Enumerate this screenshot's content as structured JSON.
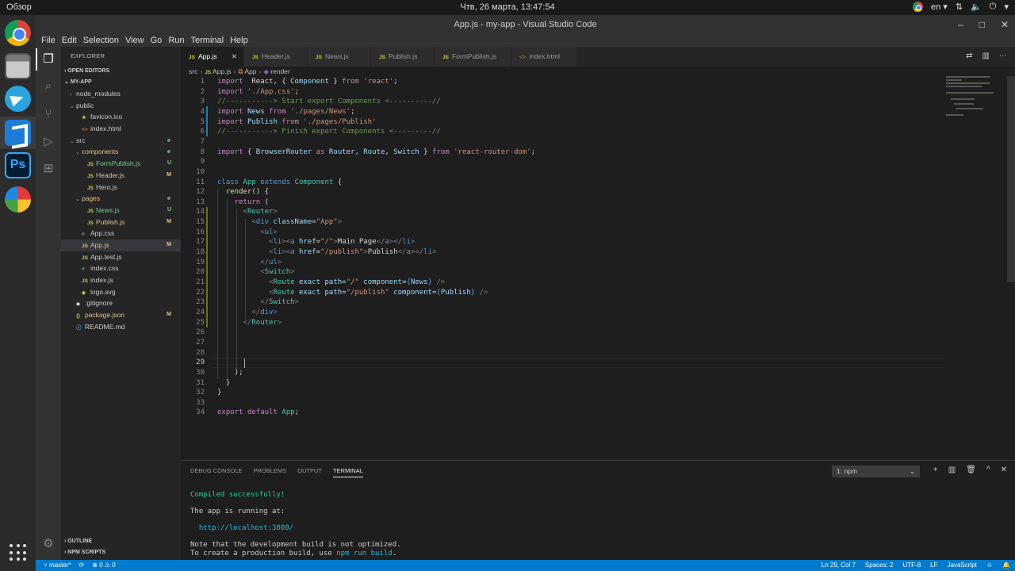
{
  "topbar": {
    "activities": "Обзор",
    "clock": "Чтв, 26 марта, 13:47:54",
    "lang": "en ▾",
    "network_icon": "network-icon",
    "volume_icon": "volume-icon",
    "power_icon": "power-icon"
  },
  "dock": {
    "apps": [
      "chrome",
      "files",
      "telegram",
      "vscode",
      "photoshop",
      "pinwheel"
    ],
    "ps_label": "Ps"
  },
  "window": {
    "title": "App.js - my-app - Visual Studio Code",
    "minimize": "–",
    "maximize": "□",
    "close": "✕"
  },
  "menu": [
    "File",
    "Edit",
    "Selection",
    "View",
    "Go",
    "Run",
    "Terminal",
    "Help"
  ],
  "sidebar": {
    "header": "EXPLORER",
    "open_editors": "OPEN EDITORS",
    "project": "MY-APP",
    "tree": [
      {
        "label": "node_modules",
        "depth": 1,
        "kind": "folder-closed"
      },
      {
        "label": "public",
        "depth": 1,
        "kind": "folder-open"
      },
      {
        "label": "favicon.ico",
        "depth": 2,
        "kind": "ico",
        "icon": "★"
      },
      {
        "label": "index.html",
        "depth": 2,
        "kind": "html",
        "icon": "<>"
      },
      {
        "label": "src",
        "depth": 1,
        "kind": "folder-open",
        "dot": true
      },
      {
        "label": "components",
        "depth": 2,
        "kind": "folder-open",
        "dot": true,
        "color": "m"
      },
      {
        "label": "FormPublish.js",
        "depth": 3,
        "kind": "js",
        "icon": "JS",
        "badge": "U",
        "color": "u"
      },
      {
        "label": "Header.js",
        "depth": 3,
        "kind": "js",
        "icon": "JS",
        "badge": "M",
        "color": "m"
      },
      {
        "label": "Hero.js",
        "depth": 3,
        "kind": "js",
        "icon": "JS"
      },
      {
        "label": "pages",
        "depth": 2,
        "kind": "folder-open",
        "dot": true,
        "color": "m"
      },
      {
        "label": "News.js",
        "depth": 3,
        "kind": "js",
        "icon": "JS",
        "badge": "U",
        "color": "u"
      },
      {
        "label": "Publish.js",
        "depth": 3,
        "kind": "js",
        "icon": "JS",
        "badge": "M",
        "color": "m"
      },
      {
        "label": "App.css",
        "depth": 2,
        "kind": "css",
        "icon": "#"
      },
      {
        "label": "App.js",
        "depth": 2,
        "kind": "js",
        "icon": "JS",
        "badge": "M",
        "color": "m",
        "selected": true
      },
      {
        "label": "App.test.js",
        "depth": 2,
        "kind": "js",
        "icon": "JS"
      },
      {
        "label": "index.css",
        "depth": 2,
        "kind": "css",
        "icon": "#"
      },
      {
        "label": "index.js",
        "depth": 2,
        "kind": "js",
        "icon": "JS"
      },
      {
        "label": "logo.svg",
        "depth": 2,
        "kind": "svg",
        "icon": "◈"
      },
      {
        "label": ".gitignore",
        "depth": 1,
        "kind": "git",
        "icon": "◆"
      },
      {
        "label": "package.json",
        "depth": 1,
        "kind": "json",
        "icon": "{}",
        "badge": "M",
        "color": "m"
      },
      {
        "label": "README.md",
        "depth": 1,
        "kind": "md",
        "icon": "ⓘ"
      }
    ],
    "outline": "OUTLINE",
    "npm_scripts": "NPM SCRIPTS"
  },
  "tabs": [
    {
      "label": "App.js",
      "icon": "JS",
      "active": true,
      "close": "✕"
    },
    {
      "label": "Header.js",
      "icon": "JS"
    },
    {
      "label": "News.js",
      "icon": "JS"
    },
    {
      "label": "Publish.js",
      "icon": "JS"
    },
    {
      "label": "FormPublish.js",
      "icon": "JS"
    },
    {
      "label": "index.html",
      "icon": "<>"
    }
  ],
  "breadcrumb": {
    "folder": "src",
    "file": "App.js",
    "class": "App",
    "method": "render",
    "sep": "›"
  },
  "code_lines": [
    [
      [
        "k2",
        "import"
      ],
      [
        "",
        "  React, { "
      ],
      [
        "v",
        "Component"
      ],
      [
        "",
        " } "
      ],
      [
        "k2",
        "from"
      ],
      [
        "",
        " "
      ],
      [
        "s",
        "'react'"
      ],
      [
        "",
        ";"
      ]
    ],
    [
      [
        "k2",
        "import"
      ],
      [
        "",
        " "
      ],
      [
        "s",
        "'./App.css'"
      ],
      [
        "",
        ";"
      ]
    ],
    [
      [
        "c",
        "//-----------> Start export Components <----------//"
      ]
    ],
    [
      [
        "k2",
        "import"
      ],
      [
        "",
        " "
      ],
      [
        "v",
        "News"
      ],
      [
        "",
        " "
      ],
      [
        "k2",
        "from"
      ],
      [
        "",
        " "
      ],
      [
        "s",
        "'./pages/News'"
      ],
      [
        "",
        ";"
      ]
    ],
    [
      [
        "k2",
        "import"
      ],
      [
        "",
        " "
      ],
      [
        "v",
        "Publish"
      ],
      [
        "",
        " "
      ],
      [
        "k2",
        "from"
      ],
      [
        "",
        " "
      ],
      [
        "s",
        "'./pages/Publish'"
      ]
    ],
    [
      [
        "c",
        "//-----------> Finish export Components <---------//"
      ]
    ],
    [],
    [
      [
        "k2",
        "import"
      ],
      [
        "",
        " { "
      ],
      [
        "v",
        "BrowserRouter"
      ],
      [
        "",
        " "
      ],
      [
        "k2",
        "as"
      ],
      [
        "",
        " "
      ],
      [
        "v",
        "Router"
      ],
      [
        "",
        ", "
      ],
      [
        "v",
        "Route"
      ],
      [
        "",
        ", "
      ],
      [
        "v",
        "Switch"
      ],
      [
        "",
        " } "
      ],
      [
        "k2",
        "from"
      ],
      [
        "",
        " "
      ],
      [
        "s",
        "'react-router-dom'"
      ],
      [
        "",
        ";"
      ]
    ],
    [],
    [],
    [
      [
        "k",
        "class"
      ],
      [
        "",
        " "
      ],
      [
        "cls",
        "App"
      ],
      [
        "",
        " "
      ],
      [
        "k",
        "extends"
      ],
      [
        "",
        " "
      ],
      [
        "cls",
        "Component"
      ],
      [
        "",
        " {"
      ]
    ],
    [
      [
        "",
        "  "
      ],
      [
        "f",
        "render"
      ],
      [
        "",
        "() {"
      ]
    ],
    [
      [
        "",
        "    "
      ],
      [
        "k2",
        "return"
      ],
      [
        "",
        " ("
      ]
    ],
    [
      [
        "",
        "      "
      ],
      [
        "tag",
        "<"
      ],
      [
        "cls",
        "Router"
      ],
      [
        "tag",
        ">"
      ]
    ],
    [
      [
        "",
        "        "
      ],
      [
        "tag",
        "<"
      ],
      [
        "t",
        "div"
      ],
      [
        "",
        " "
      ],
      [
        "a",
        "className"
      ],
      [
        "",
        "="
      ],
      [
        "s",
        "\"App\""
      ],
      [
        "tag",
        ">"
      ]
    ],
    [
      [
        "",
        "          "
      ],
      [
        "tag",
        "<"
      ],
      [
        "t",
        "ul"
      ],
      [
        "tag",
        ">"
      ]
    ],
    [
      [
        "",
        "            "
      ],
      [
        "tag",
        "<"
      ],
      [
        "t",
        "li"
      ],
      [
        "tag",
        "><"
      ],
      [
        "t",
        "a"
      ],
      [
        "",
        " "
      ],
      [
        "a",
        "href"
      ],
      [
        "",
        "="
      ],
      [
        "s",
        "\"/\""
      ],
      [
        "tag",
        ">"
      ],
      [
        "",
        "Main Page"
      ],
      [
        "tag",
        "</"
      ],
      [
        "t",
        "a"
      ],
      [
        "tag",
        "></"
      ],
      [
        "t",
        "li"
      ],
      [
        "tag",
        ">"
      ]
    ],
    [
      [
        "",
        "            "
      ],
      [
        "tag",
        "<"
      ],
      [
        "t",
        "li"
      ],
      [
        "tag",
        "><"
      ],
      [
        "t",
        "a"
      ],
      [
        "",
        " "
      ],
      [
        "a",
        "href"
      ],
      [
        "",
        "="
      ],
      [
        "s",
        "\"/publish\""
      ],
      [
        "tag",
        ">"
      ],
      [
        "",
        "Publish"
      ],
      [
        "tag",
        "</"
      ],
      [
        "t",
        "a"
      ],
      [
        "tag",
        "></"
      ],
      [
        "t",
        "li"
      ],
      [
        "tag",
        ">"
      ]
    ],
    [
      [
        "",
        "          "
      ],
      [
        "tag",
        "</"
      ],
      [
        "t",
        "ul"
      ],
      [
        "tag",
        ">"
      ]
    ],
    [
      [
        "",
        "          "
      ],
      [
        "tag",
        "<"
      ],
      [
        "cls",
        "Switch"
      ],
      [
        "tag",
        ">"
      ]
    ],
    [
      [
        "",
        "            "
      ],
      [
        "tag",
        "<"
      ],
      [
        "cls",
        "Route"
      ],
      [
        "",
        " "
      ],
      [
        "a",
        "exact"
      ],
      [
        "",
        " "
      ],
      [
        "a",
        "path"
      ],
      [
        "",
        "="
      ],
      [
        "s",
        "\"/\""
      ],
      [
        "",
        " "
      ],
      [
        "a",
        "component"
      ],
      [
        "",
        "="
      ],
      [
        "k",
        "{"
      ],
      [
        "v",
        "News"
      ],
      [
        "k",
        "}"
      ],
      [
        "",
        " "
      ],
      [
        "tag",
        "/>"
      ]
    ],
    [
      [
        "",
        "            "
      ],
      [
        "tag",
        "<"
      ],
      [
        "cls",
        "Route"
      ],
      [
        "",
        " "
      ],
      [
        "a",
        "exact"
      ],
      [
        "",
        " "
      ],
      [
        "a",
        "path"
      ],
      [
        "",
        "="
      ],
      [
        "s",
        "\"/publish\""
      ],
      [
        "",
        " "
      ],
      [
        "a",
        "component"
      ],
      [
        "",
        "="
      ],
      [
        "k",
        "{"
      ],
      [
        "v",
        "Publish"
      ],
      [
        "k",
        "}"
      ],
      [
        "",
        " "
      ],
      [
        "tag",
        "/>"
      ]
    ],
    [
      [
        "",
        "          "
      ],
      [
        "tag",
        "</"
      ],
      [
        "cls",
        "Switch"
      ],
      [
        "tag",
        ">"
      ]
    ],
    [
      [
        "",
        "        "
      ],
      [
        "tag",
        "</"
      ],
      [
        "t",
        "div"
      ],
      [
        "tag",
        ">"
      ]
    ],
    [
      [
        "",
        "      "
      ],
      [
        "tag",
        "</"
      ],
      [
        "cls",
        "Router"
      ],
      [
        "tag",
        ">"
      ]
    ],
    [],
    [],
    [],
    [],
    [
      [
        "",
        "    );"
      ]
    ],
    [
      [
        "",
        "  }"
      ]
    ],
    [
      [
        "",
        "}"
      ]
    ],
    [],
    [
      [
        "k2",
        "export"
      ],
      [
        "",
        " "
      ],
      [
        "k2",
        "default"
      ],
      [
        "",
        " "
      ],
      [
        "cls",
        "App"
      ],
      [
        "",
        ";"
      ]
    ]
  ],
  "panel": {
    "tabs": [
      "DEBUG CONSOLE",
      "PROBLEMS",
      "OUTPUT",
      "TERMINAL"
    ],
    "active_tab": "TERMINAL",
    "terminal_select": "1: npm",
    "select_arrow": "⌄",
    "icons": {
      "add": "+",
      "split": "▥",
      "trash": "🗑",
      "maximize": "^",
      "close": "✕"
    },
    "lines": [
      {
        "text": "Compiled successfully!",
        "cls": "green"
      },
      {
        "text": "",
        "cls": ""
      },
      {
        "text": "The app is running at:",
        "cls": ""
      },
      {
        "text": "",
        "cls": ""
      },
      {
        "text": "  http://localhost:3000/",
        "cls": "cyan"
      },
      {
        "text": "",
        "cls": ""
      },
      {
        "text": "Note that the development build is not optimized.",
        "cls": ""
      }
    ],
    "last_line_prefix": "To create a production build, use ",
    "last_line_cmd": "npm run build",
    "last_line_suffix": "."
  },
  "status": {
    "branch": "master*",
    "sync": "⟳",
    "problems": "⊗ 0 ⚠ 0",
    "position": "Ln 29, Col 7",
    "spaces": "Spaces: 2",
    "encoding": "UTF-8",
    "eol": "LF",
    "language": "JavaScript",
    "feedback": "☺",
    "bell": "🔔"
  }
}
